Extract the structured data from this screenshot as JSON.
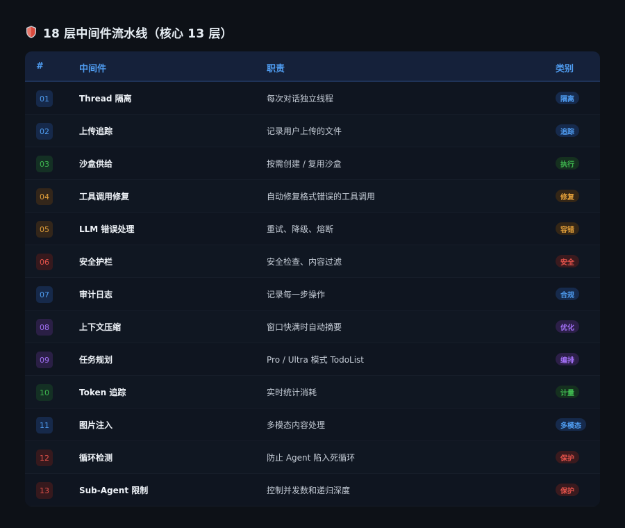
{
  "title": "18 层中间件流水线（核心 13 层）",
  "colors": {
    "background": "#0d1117",
    "header_bg": "#15213a",
    "header_text": "#4f9cf0",
    "blue": "#4f9cf0",
    "green": "#3fb950",
    "orange": "#e3a03a",
    "red": "#e5534b",
    "purple": "#a371f7"
  },
  "table": {
    "headers": {
      "num": "#",
      "name": "中间件",
      "desc": "职责",
      "category": "类别"
    },
    "rows": [
      {
        "num": "01",
        "name": "Thread 隔离",
        "desc": "每次对话独立线程",
        "category": "隔离",
        "tone": "blue"
      },
      {
        "num": "02",
        "name": "上传追踪",
        "desc": "记录用户上传的文件",
        "category": "追踪",
        "tone": "blue"
      },
      {
        "num": "03",
        "name": "沙盒供给",
        "desc": "按需创建 / 复用沙盒",
        "category": "执行",
        "tone": "green"
      },
      {
        "num": "04",
        "name": "工具调用修复",
        "desc": "自动修复格式错误的工具调用",
        "category": "修复",
        "tone": "orange"
      },
      {
        "num": "05",
        "name": "LLM 错误处理",
        "desc": "重试、降级、熔断",
        "category": "容错",
        "tone": "orange"
      },
      {
        "num": "06",
        "name": "安全护栏",
        "desc": "安全检查、内容过滤",
        "category": "安全",
        "tone": "red"
      },
      {
        "num": "07",
        "name": "审计日志",
        "desc": "记录每一步操作",
        "category": "合规",
        "tone": "blue"
      },
      {
        "num": "08",
        "name": "上下文压缩",
        "desc": "窗口快满时自动摘要",
        "category": "优化",
        "tone": "purple"
      },
      {
        "num": "09",
        "name": "任务规划",
        "desc": "Pro / Ultra 模式 TodoList",
        "category": "编排",
        "tone": "purple"
      },
      {
        "num": "10",
        "name": "Token 追踪",
        "desc": "实时统计消耗",
        "category": "计量",
        "tone": "green"
      },
      {
        "num": "11",
        "name": "图片注入",
        "desc": "多模态内容处理",
        "category": "多模态",
        "tone": "blue"
      },
      {
        "num": "12",
        "name": "循环检测",
        "desc": "防止 Agent 陷入死循环",
        "category": "保护",
        "tone": "red"
      },
      {
        "num": "13",
        "name": "Sub-Agent 限制",
        "desc": "控制并发数和递归深度",
        "category": "保护",
        "tone": "red"
      }
    ]
  },
  "icons": {
    "title_icon": "shield-icon"
  }
}
